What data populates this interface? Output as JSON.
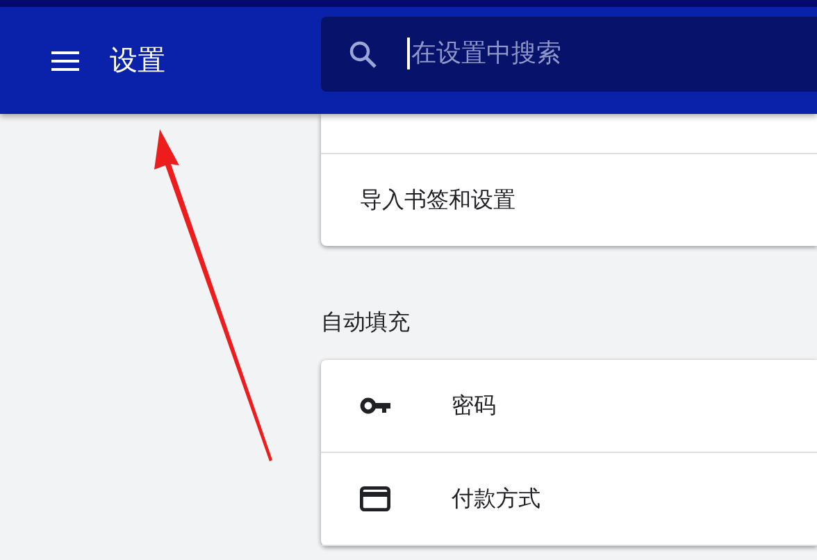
{
  "header": {
    "title": "设置",
    "search": {
      "placeholder": "在设置中搜索"
    }
  },
  "sections": [
    {
      "items": [
        {
          "label": "导入书签和设置",
          "kind": "plain"
        }
      ]
    },
    {
      "title": "自动填充",
      "items": [
        {
          "label": "密码",
          "kind": "key"
        },
        {
          "label": "付款方式",
          "kind": "card"
        }
      ]
    }
  ]
}
